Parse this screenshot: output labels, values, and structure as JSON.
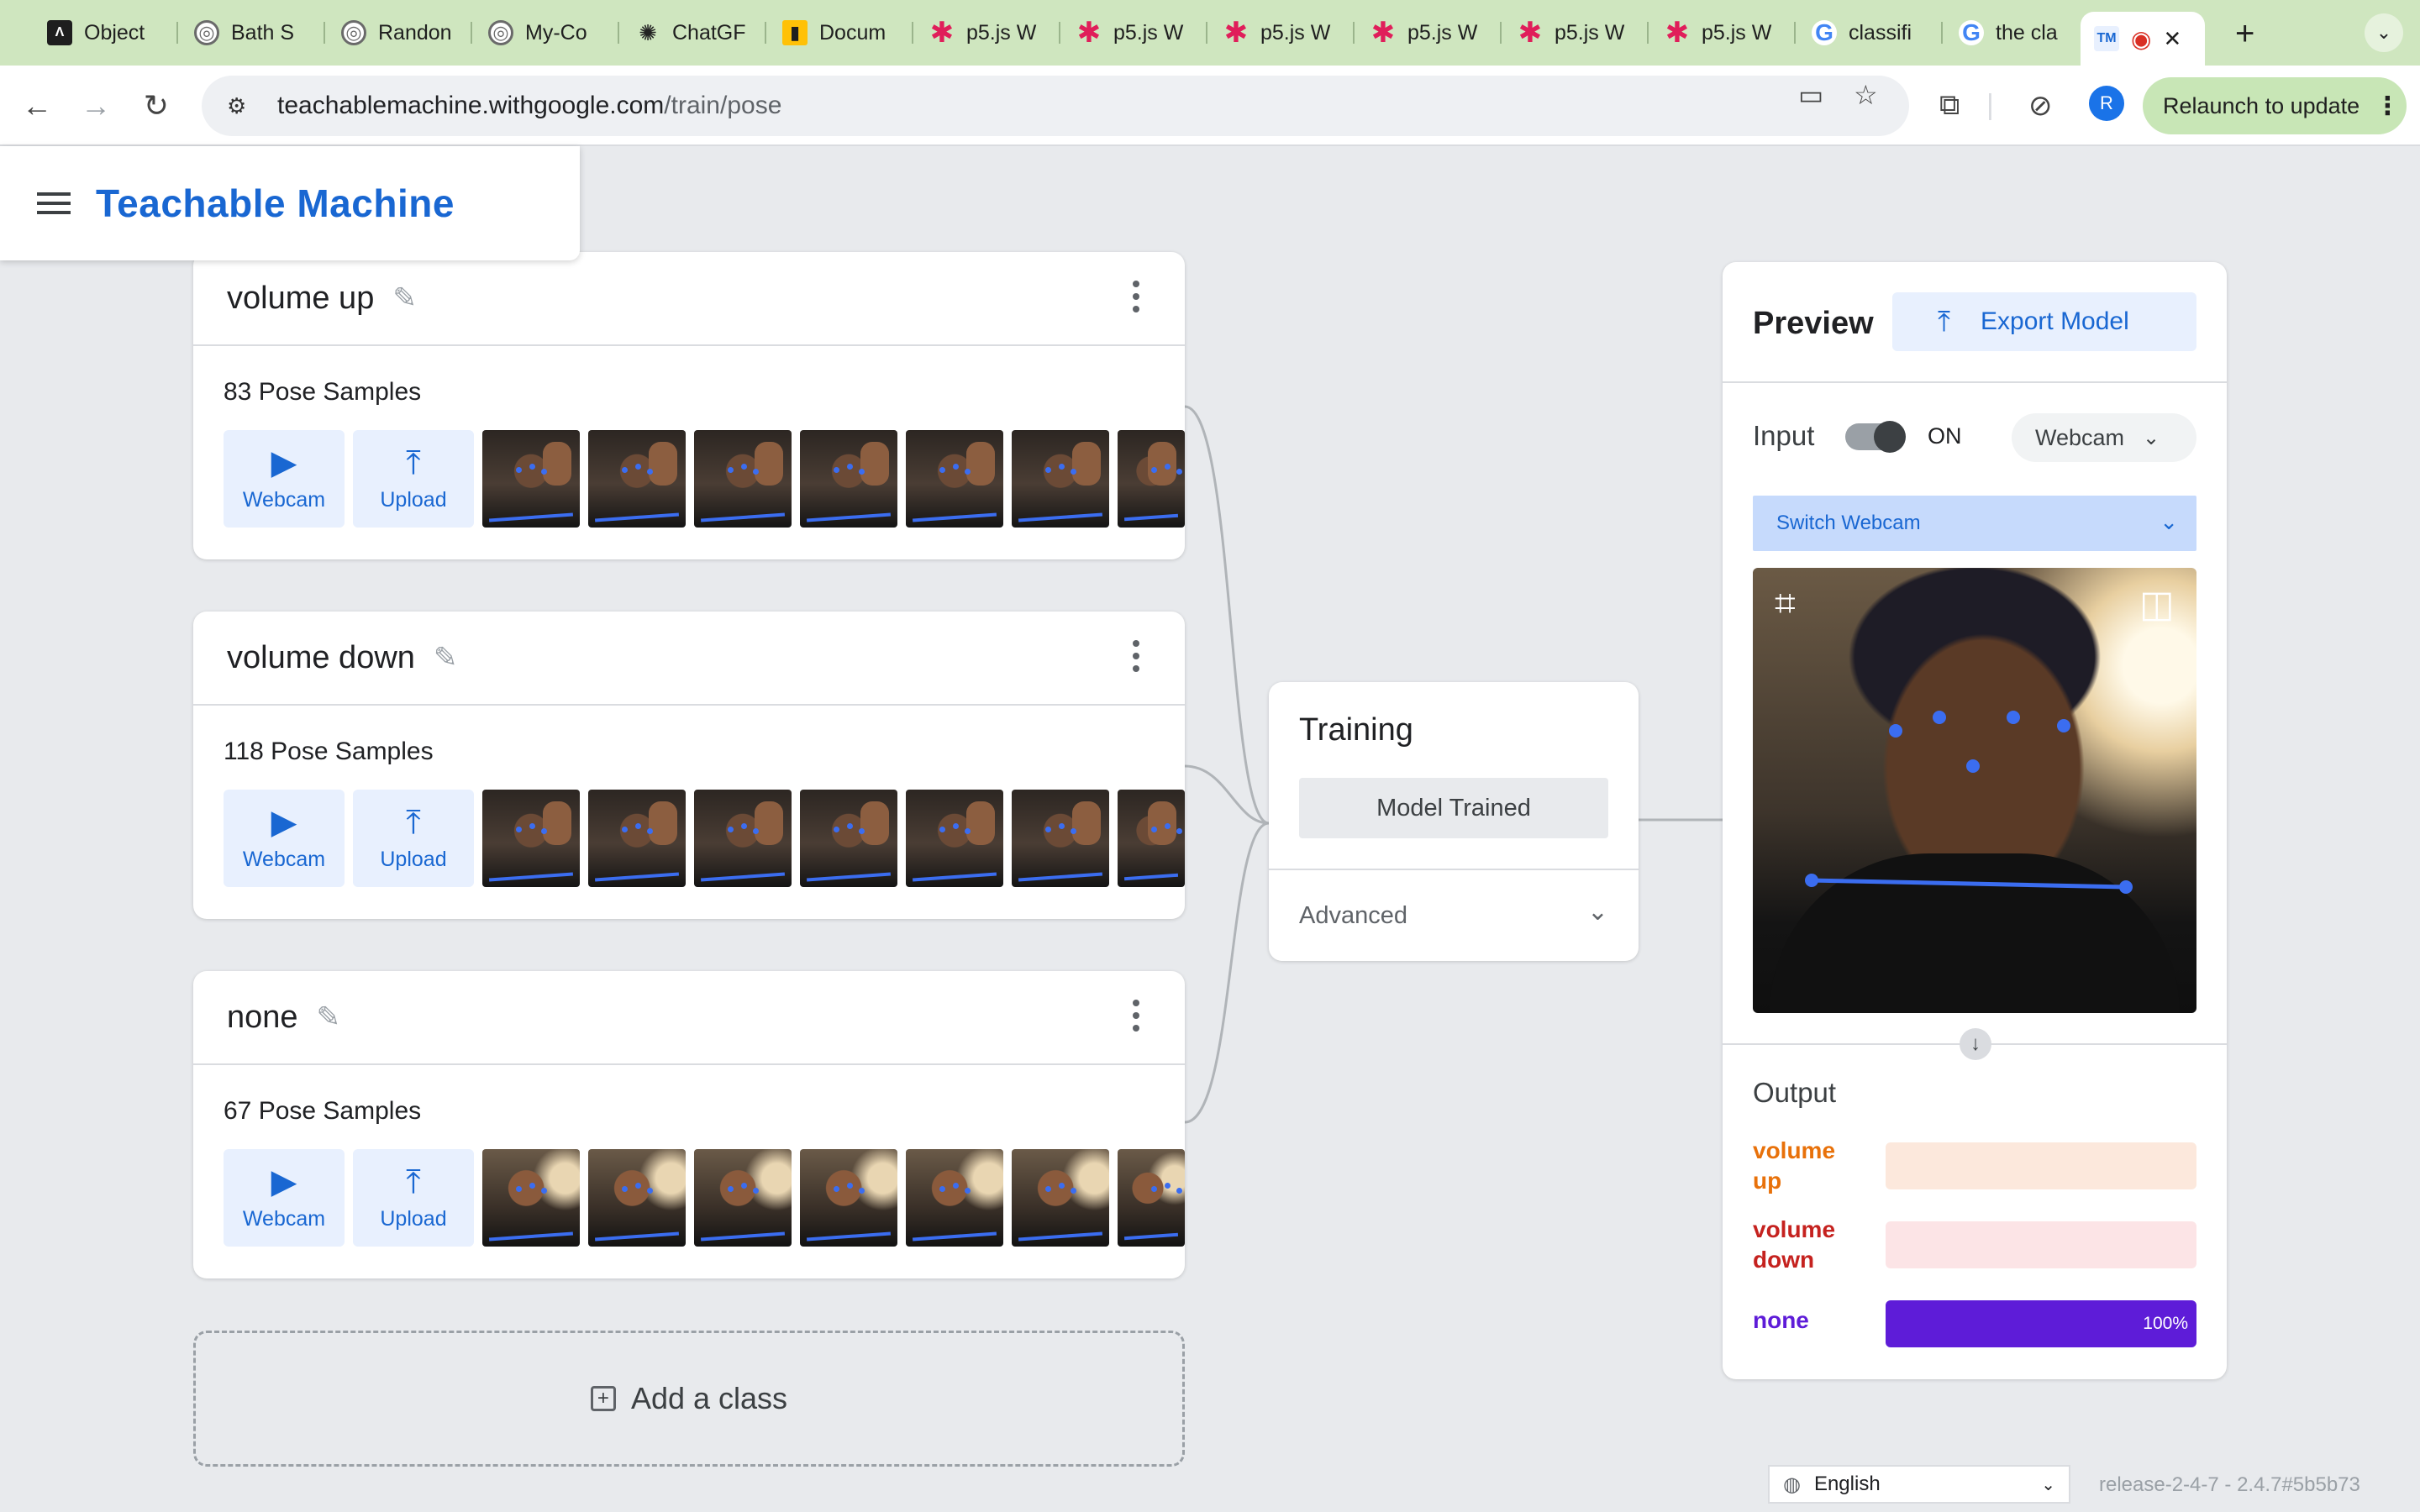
{
  "browser": {
    "tabs": [
      {
        "title": "Object",
        "icon": "obj"
      },
      {
        "title": "Bath S",
        "icon": "globe"
      },
      {
        "title": "Randon",
        "icon": "globe"
      },
      {
        "title": "My-Co",
        "icon": "globe"
      },
      {
        "title": "ChatGF",
        "icon": "gpt"
      },
      {
        "title": "Docum",
        "icon": "bars"
      },
      {
        "title": "p5.js W",
        "icon": "star"
      },
      {
        "title": "p5.js W",
        "icon": "star"
      },
      {
        "title": "p5.js W",
        "icon": "star"
      },
      {
        "title": "p5.js W",
        "icon": "star"
      },
      {
        "title": "p5.js W",
        "icon": "star"
      },
      {
        "title": "p5.js W",
        "icon": "star"
      },
      {
        "title": "classifi",
        "icon": "google"
      },
      {
        "title": "the cla",
        "icon": "google"
      }
    ],
    "active_tab": {
      "icon_text": "TM"
    },
    "url_host": "teachablemachine.withgoogle.com",
    "url_path": "/train/pose",
    "avatar_letter": "R",
    "relaunch_label": "Relaunch to update"
  },
  "app": {
    "title": "Teachable Machine"
  },
  "classes": [
    {
      "name": "volume up",
      "samples": "83 Pose Samples",
      "thumb_style": "wave-up"
    },
    {
      "name": "volume down",
      "samples": "118 Pose Samples",
      "thumb_style": "wave-down"
    },
    {
      "name": "none",
      "samples": "67 Pose Samples",
      "thumb_style": "still"
    }
  ],
  "sample_buttons": {
    "webcam": "Webcam",
    "upload": "Upload"
  },
  "add_class_label": "Add a class",
  "training": {
    "title": "Training",
    "button_label": "Model Trained",
    "advanced_label": "Advanced"
  },
  "preview": {
    "title": "Preview",
    "export_label": "Export Model",
    "input_label": "Input",
    "toggle_state": "ON",
    "source_label": "Webcam",
    "switch_webcam_label": "Switch Webcam",
    "output_label": "Output",
    "outputs": [
      {
        "name_line1": "volume",
        "name_line2": "up",
        "value": 0,
        "pct_label": "",
        "color": "#e8710a",
        "track": "#fce8dc"
      },
      {
        "name_line1": "volume",
        "name_line2": "down",
        "value": 0,
        "pct_label": "",
        "color": "#c5221f",
        "track": "#fce4e6"
      },
      {
        "name_line1": "none",
        "name_line2": "",
        "value": 1.0,
        "pct_label": "100%",
        "color": "#5e1cd8",
        "track": "#e5dcf8"
      }
    ]
  },
  "footer": {
    "language": "English",
    "release": "release-2-4-7 - 2.4.7#5b5b73"
  },
  "colors": {
    "brand_blue": "#1967d2",
    "tab_bar": "#cfe6bf",
    "pose_line": "#3b6df0"
  }
}
